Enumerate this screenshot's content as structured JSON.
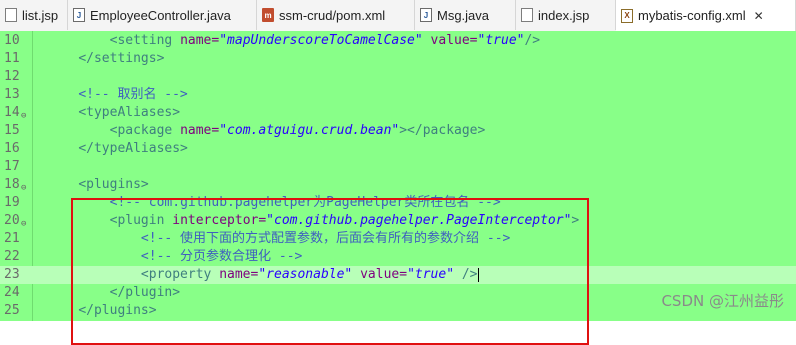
{
  "tabs": [
    {
      "label": "list.jsp",
      "icon": "jsp-file-icon",
      "active": false
    },
    {
      "label": "EmployeeController.java",
      "icon": "java-file-icon",
      "active": false
    },
    {
      "label": "ssm-crud/pom.xml",
      "icon": "maven-file-icon",
      "active": false
    },
    {
      "label": "Msg.java",
      "icon": "java-file-icon",
      "active": false
    },
    {
      "label": "index.jsp",
      "icon": "jsp-file-icon",
      "active": false
    },
    {
      "label": "mybatis-config.xml",
      "icon": "xml-file-icon",
      "active": true,
      "close": "✕"
    }
  ],
  "editor": {
    "current_line": 23,
    "lines": [
      {
        "num": "10",
        "fold": "",
        "tokens": [
          [
            "plain",
            "        "
          ],
          [
            "tag",
            "<setting "
          ],
          [
            "attr",
            "name="
          ],
          [
            "val",
            "\"mapUnderscoreToCamelCase\""
          ],
          [
            "plain",
            " "
          ],
          [
            "attr",
            "value="
          ],
          [
            "val",
            "\"true\""
          ],
          [
            "tag",
            "/>"
          ]
        ]
      },
      {
        "num": "11",
        "fold": "",
        "tokens": [
          [
            "plain",
            "    "
          ],
          [
            "tag",
            "</settings>"
          ]
        ]
      },
      {
        "num": "12",
        "fold": "",
        "tokens": []
      },
      {
        "num": "13",
        "fold": "",
        "tokens": [
          [
            "plain",
            "    "
          ],
          [
            "comment",
            "<!-- 取别名 -->"
          ]
        ]
      },
      {
        "num": "14",
        "fold": "⊖",
        "tokens": [
          [
            "plain",
            "    "
          ],
          [
            "tag",
            "<typeAliases>"
          ]
        ]
      },
      {
        "num": "15",
        "fold": "",
        "tokens": [
          [
            "plain",
            "        "
          ],
          [
            "tag",
            "<package "
          ],
          [
            "attr",
            "name="
          ],
          [
            "val",
            "\"com.atguigu.crud.bean\""
          ],
          [
            "tag",
            "></package>"
          ]
        ]
      },
      {
        "num": "16",
        "fold": "",
        "tokens": [
          [
            "plain",
            "    "
          ],
          [
            "tag",
            "</typeAliases>"
          ]
        ]
      },
      {
        "num": "17",
        "fold": "",
        "tokens": []
      },
      {
        "num": "18",
        "fold": "⊖",
        "tokens": [
          [
            "plain",
            "    "
          ],
          [
            "tag",
            "<plugins>"
          ]
        ]
      },
      {
        "num": "19",
        "fold": "",
        "tokens": [
          [
            "plain",
            "        "
          ],
          [
            "comment",
            "<!-- com.github.pagehelper为PageHelper类所在包名 -->"
          ]
        ]
      },
      {
        "num": "20",
        "fold": "⊖",
        "tokens": [
          [
            "plain",
            "        "
          ],
          [
            "tag",
            "<plugin "
          ],
          [
            "attr",
            "interceptor="
          ],
          [
            "val",
            "\"com.github.pagehelper.PageInterceptor\""
          ],
          [
            "tag",
            ">"
          ]
        ]
      },
      {
        "num": "21",
        "fold": "",
        "tokens": [
          [
            "plain",
            "            "
          ],
          [
            "comment",
            "<!-- 使用下面的方式配置参数，后面会有所有的参数介绍 -->"
          ]
        ]
      },
      {
        "num": "22",
        "fold": "",
        "tokens": [
          [
            "plain",
            "            "
          ],
          [
            "comment",
            "<!-- 分页参数合理化 -->"
          ]
        ]
      },
      {
        "num": "23",
        "fold": "",
        "tokens": [
          [
            "plain",
            "            "
          ],
          [
            "tag",
            "<property "
          ],
          [
            "attr",
            "name="
          ],
          [
            "val",
            "\"reasonable\""
          ],
          [
            "plain",
            " "
          ],
          [
            "attr",
            "value="
          ],
          [
            "val",
            "\"true\""
          ],
          [
            "plain",
            " "
          ],
          [
            "tag",
            "/>"
          ]
        ]
      },
      {
        "num": "24",
        "fold": "",
        "tokens": [
          [
            "plain",
            "        "
          ],
          [
            "tag",
            "</plugin>"
          ]
        ]
      },
      {
        "num": "25",
        "fold": "",
        "tokens": [
          [
            "plain",
            "    "
          ],
          [
            "tag",
            "</plugins>"
          ]
        ]
      }
    ]
  },
  "watermark": "CSDN @江州益彤",
  "colors": {
    "editor_bg": "#88ff88",
    "highlight_border": "#e01010",
    "tag": "#3f7f7f",
    "attribute": "#7f007f",
    "string": "#2a00ff",
    "comment": "#3f5fbf"
  }
}
